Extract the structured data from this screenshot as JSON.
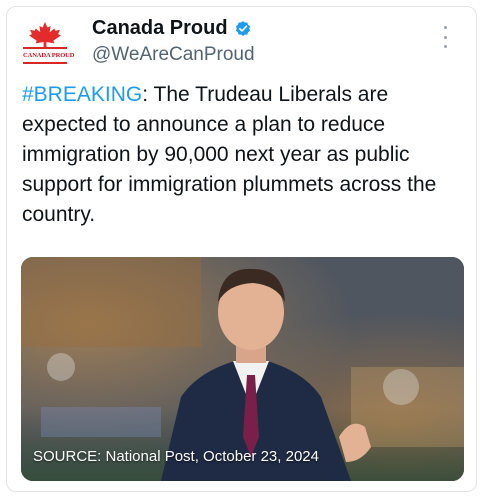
{
  "account": {
    "name": "Canada Proud",
    "handle": "@WeAreCanProud",
    "logo_text": "CANADA PROUD",
    "verified_color": "#1d9bf0"
  },
  "tweet": {
    "hashtag": "#BREAKING",
    "text": ": The Trudeau Liberals are expected to announce a plan to reduce immigration by 90,000 next year as public support for immigration plummets across the country."
  },
  "media": {
    "caption": "SOURCE: National Post, October 23, 2024"
  },
  "colors": {
    "hashtag": "#1d9bf0",
    "maple_leaf": "#e32b2b"
  }
}
